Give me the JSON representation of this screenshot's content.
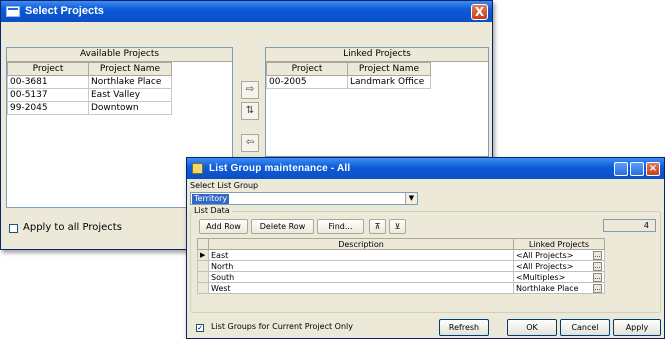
{
  "select_projects": {
    "title": "Select Projects",
    "close_label": "X",
    "available": {
      "header": "Available Projects",
      "columns": [
        "Project",
        "Project Name"
      ],
      "rows": [
        {
          "project": "00-3681",
          "name": "Northlake Place"
        },
        {
          "project": "00-5137",
          "name": "East Valley"
        },
        {
          "project": "99-2045",
          "name": "Downtown"
        }
      ]
    },
    "linked": {
      "header": "Linked Projects",
      "columns": [
        "Project",
        "Project Name"
      ],
      "rows": [
        {
          "project": "00-2005",
          "name": "Landmark Office"
        }
      ]
    },
    "apply_all_label": "Apply to all Projects"
  },
  "list_group": {
    "title": "List Group maintenance - All",
    "select_label": "Select List Group",
    "select_value": "Territory",
    "list_data_label": "List Data",
    "buttons": {
      "add_row": "Add Row",
      "delete_row": "Delete Row",
      "find": "Find...",
      "refresh": "Refresh",
      "ok": "OK",
      "cancel": "Cancel",
      "apply": "Apply"
    },
    "count": "4",
    "columns": [
      "Description",
      "Linked Projects"
    ],
    "rows": [
      {
        "description": "East",
        "linked": "<All Projects>"
      },
      {
        "description": "North",
        "linked": "<All Projects>"
      },
      {
        "description": "South",
        "linked": "<Multiples>"
      },
      {
        "description": "West",
        "linked": "Northlake Place"
      }
    ],
    "current_only_label": "List Groups for Current Project Only"
  }
}
